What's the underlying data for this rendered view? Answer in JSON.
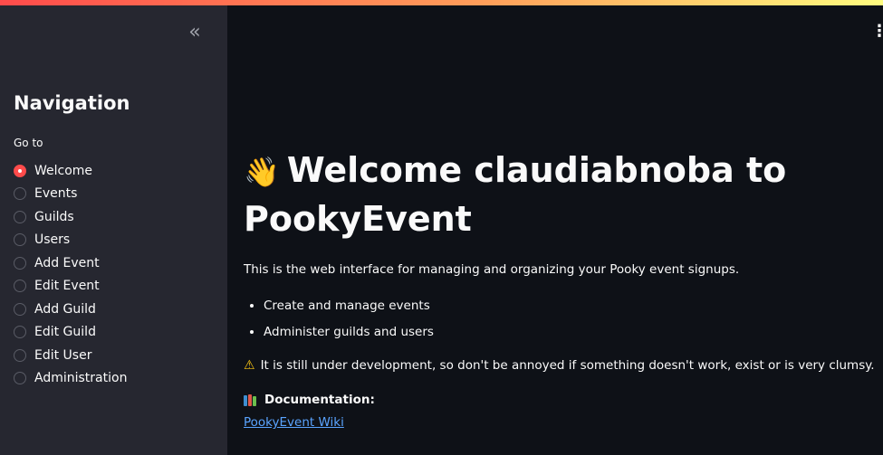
{
  "sidebar": {
    "collapse_icon": "«",
    "title": "Navigation",
    "radio_label": "Go to",
    "selected": "Welcome",
    "items": [
      "Welcome",
      "Events",
      "Guilds",
      "Users",
      "Add Event",
      "Edit Event",
      "Add Guild",
      "Edit Guild",
      "Edit User",
      "Administration"
    ]
  },
  "header": {
    "menu_icon": "⋮"
  },
  "main": {
    "emoji": "👋",
    "title": "Welcome claudiabnoba to PookyEvent",
    "intro": "This is the web interface for managing and organizing your Pooky event signups.",
    "bullets": [
      "Create and manage events",
      "Administer guilds and users"
    ],
    "warning_icon": "⚠",
    "warning": "It is still under development, so don't be annoyed if something doesn't work, exist or is very clumsy.",
    "doc_heading": "Documentation:",
    "doc_link": "PookyEvent Wiki"
  },
  "colors": {
    "accent": "#ff4b4b",
    "background": "#0e1117",
    "sidebar": "#262730",
    "link": "#5aa4ff"
  }
}
